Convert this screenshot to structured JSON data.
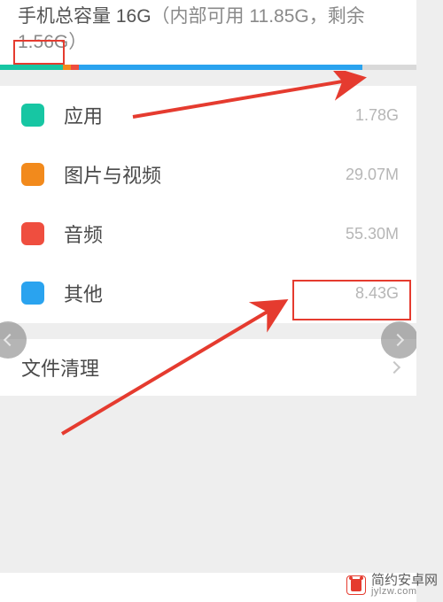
{
  "header": {
    "title_prefix": "手机总容量 ",
    "total": "16G",
    "paren_open": "（内部可用 ",
    "usable": "11.85G",
    "paren_mid": "，剩余 ",
    "remaining": "1.56G",
    "paren_close": "）"
  },
  "progress": {
    "segments": [
      {
        "color": "#17c6a3",
        "start": 0,
        "width": 15
      },
      {
        "color": "#f28a1c",
        "start": 15,
        "width": 2
      },
      {
        "color": "#ef4e3f",
        "start": 17,
        "width": 2
      },
      {
        "color": "#2aa3ef",
        "start": 19,
        "width": 68
      }
    ]
  },
  "categories": [
    {
      "name": "apps",
      "label": "应用",
      "value": "1.78G",
      "color": "#17c6a3"
    },
    {
      "name": "media",
      "label": "图片与视频",
      "value": "29.07M",
      "color": "#f28a1c"
    },
    {
      "name": "audio",
      "label": "音频",
      "value": "55.30M",
      "color": "#ef4e3f"
    },
    {
      "name": "other",
      "label": "其他",
      "value": "8.43G",
      "color": "#2aa3ef"
    }
  ],
  "clean": {
    "label": "文件清理"
  },
  "watermark": {
    "cn": "简约安卓网",
    "url": "jylzw.com"
  }
}
